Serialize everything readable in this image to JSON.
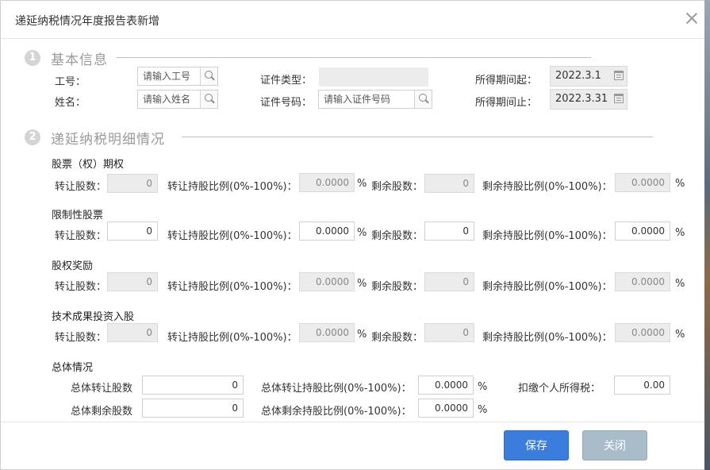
{
  "dialog": {
    "title": "递延纳税情况年度报告表新增"
  },
  "basic": {
    "step": "1",
    "title": "基本信息",
    "staff_no_label": "工号：",
    "staff_no_placeholder": "请输入工号",
    "name_label": "姓名：",
    "name_placeholder": "请输入姓名",
    "id_type_label": "证件类型：",
    "id_type_value": "",
    "id_no_label": "证件号码：",
    "id_no_placeholder": "请输入证件号码",
    "period_start_label": "所得期间起：",
    "period_start_value": "2022.3.1",
    "period_end_label": "所得期间止：",
    "period_end_value": "2022.3.31"
  },
  "detail": {
    "step": "2",
    "title": "递延纳税明细情况",
    "transfer_shares_label": "转让股数：",
    "transfer_ratio_label": "转让持股比例(0%-100%)：",
    "remain_shares_label": "剩余股数：",
    "remain_ratio_label": "剩余持股比例(0%-100%)：",
    "percent_sign": "%",
    "groups": [
      {
        "name": "股票（权）期权",
        "transfer_shares": "0",
        "transfer_ratio": "0.0000",
        "remain_shares": "0",
        "remain_ratio": "0.0000",
        "enabled": false
      },
      {
        "name": "限制性股票",
        "transfer_shares": "0",
        "transfer_ratio": "0.0000",
        "remain_shares": "0",
        "remain_ratio": "0.0000",
        "enabled": true
      },
      {
        "name": "股权奖励",
        "transfer_shares": "0",
        "transfer_ratio": "0.0000",
        "remain_shares": "0",
        "remain_ratio": "0.0000",
        "enabled": false
      },
      {
        "name": "技术成果投资入股",
        "transfer_shares": "0",
        "transfer_ratio": "0.0000",
        "remain_shares": "0",
        "remain_ratio": "0.0000",
        "enabled": false
      }
    ]
  },
  "summary": {
    "title": "总体情况",
    "total_transfer_label": "总体转让股数",
    "total_transfer_value": "0",
    "total_transfer_ratio_label": "总体转让持股比例(0%-100%)：",
    "total_transfer_ratio_value": "0.0000",
    "tax_label": "扣缴个人所得税：",
    "tax_value": "0.00",
    "total_remain_label": "总体剩余股数",
    "total_remain_value": "0",
    "total_remain_ratio_label": "总体剩余持股比例(0%-100%)：",
    "total_remain_ratio_value": "0.0000",
    "percent_sign": "%"
  },
  "footer": {
    "save_label": "保存",
    "close_label": "关闭"
  },
  "colors": {
    "primary": "#3b7ddd",
    "secondary": "#a9bcc9",
    "disabled_bg": "#ececec"
  }
}
